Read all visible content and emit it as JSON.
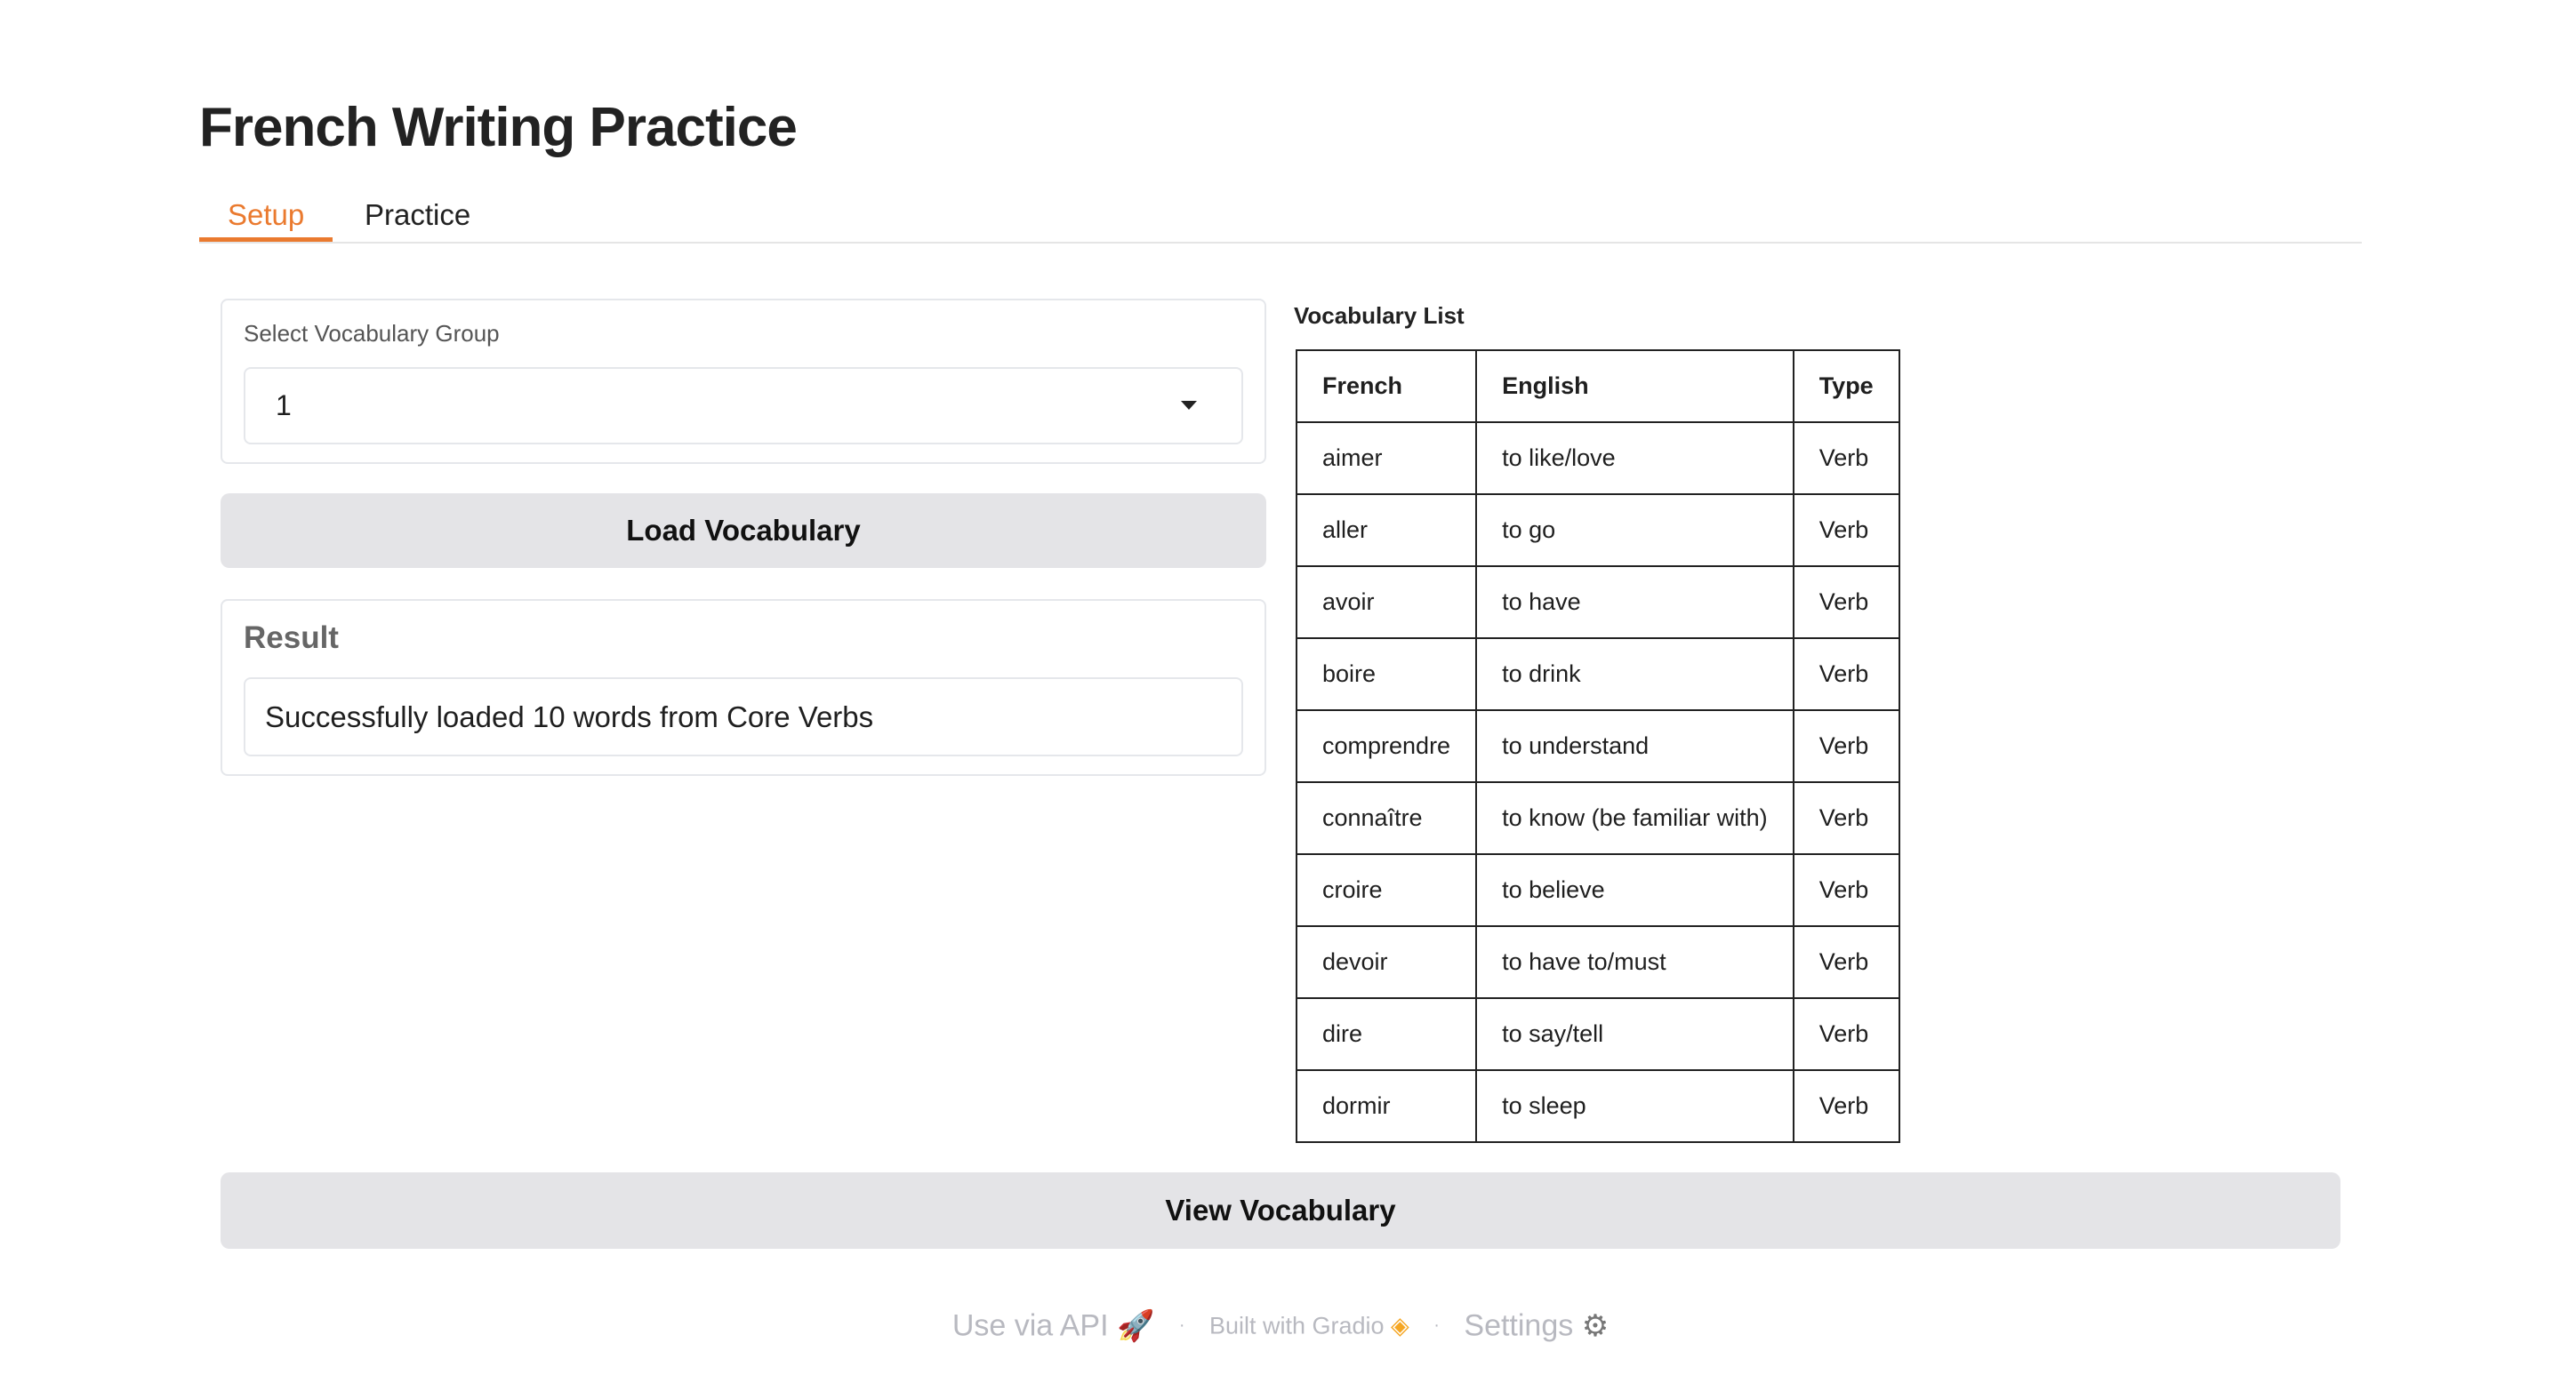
{
  "title": "French Writing Practice",
  "tabs": [
    {
      "label": "Setup",
      "active": true
    },
    {
      "label": "Practice",
      "active": false
    }
  ],
  "setup": {
    "dropdown": {
      "label": "Select Vocabulary Group",
      "value": "1"
    },
    "load_button": "Load Vocabulary",
    "result": {
      "label": "Result",
      "value": "Successfully loaded 10 words from Core Verbs"
    },
    "view_button": "View Vocabulary"
  },
  "vocab": {
    "label": "Vocabulary List",
    "headers": [
      "French",
      "English",
      "Type"
    ],
    "rows": [
      [
        "aimer",
        "to like/love",
        "Verb"
      ],
      [
        "aller",
        "to go",
        "Verb"
      ],
      [
        "avoir",
        "to have",
        "Verb"
      ],
      [
        "boire",
        "to drink",
        "Verb"
      ],
      [
        "comprendre",
        "to understand",
        "Verb"
      ],
      [
        "connaître",
        "to know (be familiar with)",
        "Verb"
      ],
      [
        "croire",
        "to believe",
        "Verb"
      ],
      [
        "devoir",
        "to have to/must",
        "Verb"
      ],
      [
        "dire",
        "to say/tell",
        "Verb"
      ],
      [
        "dormir",
        "to sleep",
        "Verb"
      ]
    ]
  },
  "footer": {
    "api": "Use via API",
    "built": "Built with Gradio",
    "settings": "Settings",
    "icons": [
      "rocket-icon",
      "gradio-logo-icon",
      "gear-icon"
    ]
  },
  "colors": {
    "accent": "#ea7a2f",
    "button_bg": "#e4e4e7"
  }
}
